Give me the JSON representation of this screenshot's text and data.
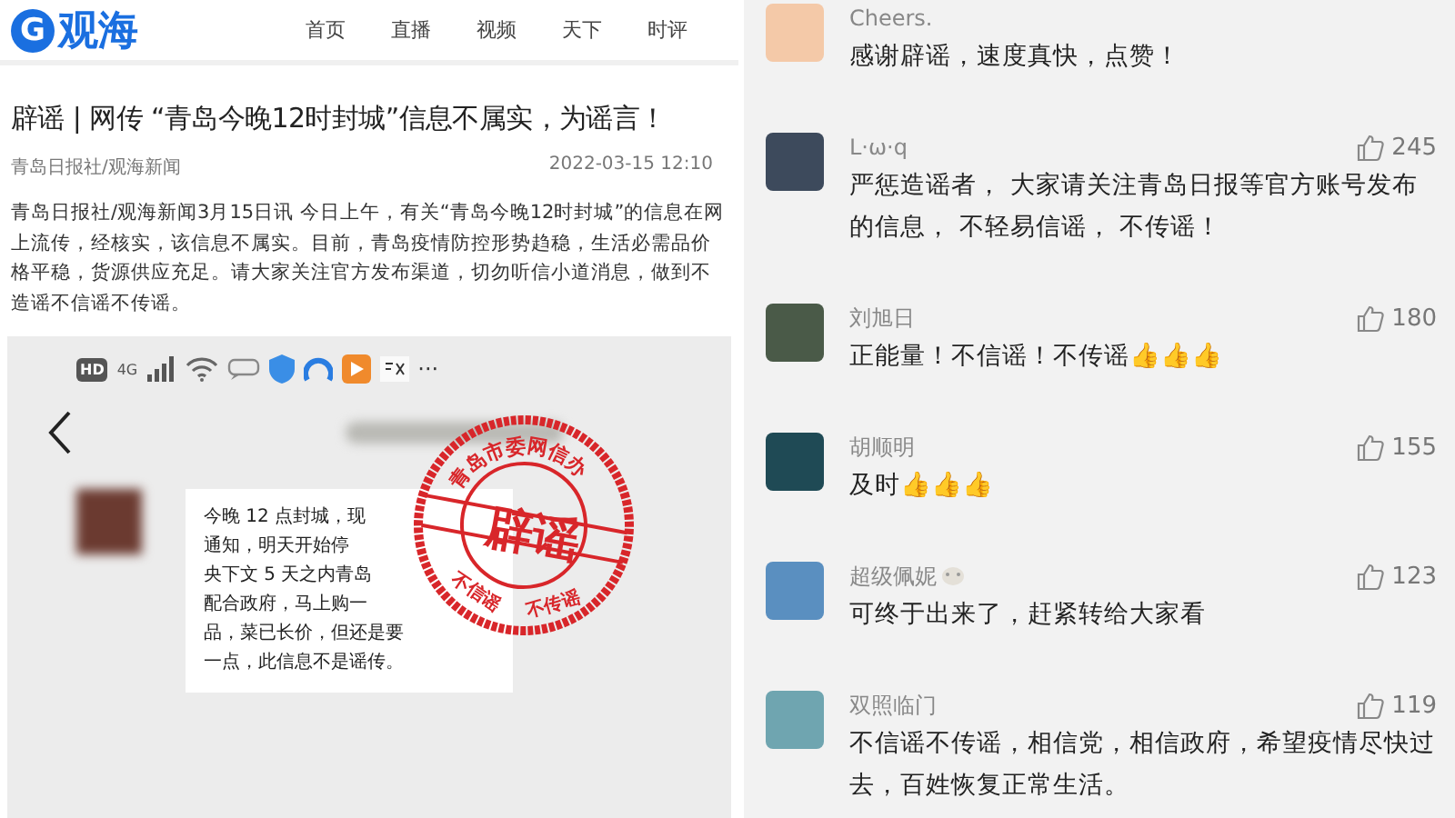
{
  "article_page": {
    "logo": {
      "mark": "G",
      "text": "观海"
    },
    "nav": [
      {
        "label": "首页"
      },
      {
        "label": "直播"
      },
      {
        "label": "视频"
      },
      {
        "label": "天下"
      },
      {
        "label": "时评"
      }
    ],
    "title": "辟谣 | 网传 “青岛今晚12时封城”信息不属实，为谣言！",
    "source": "青岛日报社/观海新闻",
    "date": "2022-03-15 12:10",
    "body": "青岛日报社/观海新闻3月15日讯 今日上午，有关“青岛今晚12时封城”的信息在网上流传，经核实，该信息不属实。目前，青岛疫情防控形势趋稳，生活必需品价格平稳，货源供应充足。请大家关注官方发布渠道，切勿听信小道消息，做到不造谣不信谣不传谣。",
    "screenshot": {
      "status_bar": {
        "hd": "HD",
        "network": "4G",
        "more": "···"
      },
      "message_lines": [
        "今晚 12 点封城，现",
        "通知，明天开始停",
        "央下文 5 天之内青岛",
        "配合政府，马上购一",
        "品，菜已长价，但还是要",
        "一点，此信息不是谣传。"
      ],
      "stamp": {
        "ring_text": "青岛市委网信办",
        "center_text": "辟谣",
        "left_text": "不信谣",
        "bottom_text": "不传谣"
      }
    }
  },
  "comments": [
    {
      "name": "Cheers.",
      "text": "感谢辟谣，速度真快，点赞！",
      "color": "#f4c9a8"
    },
    {
      "name": "L·ω·q",
      "likes": "245",
      "text": "严惩造谣者， 大家请关注青岛日报等官方账号发布的信息， 不轻易信谣， 不传谣！",
      "color": "#3d4a5c"
    },
    {
      "name": "刘旭日",
      "likes": "180",
      "text": "正能量！不信谣！不传谣👍👍👍",
      "color": "#4a5a48"
    },
    {
      "name": "胡顺明",
      "likes": "155",
      "text": "及时👍👍👍",
      "color": "#1f4a55"
    },
    {
      "name": "超级佩妮",
      "likes": "123",
      "text": "可终于出来了，赶紧转给大家看",
      "color": "#5a8fc0",
      "name_badge": true
    },
    {
      "name": "双照临门",
      "likes": "119",
      "text": "不信谣不传谣，相信党，相信政府，希望疫情尽快过去，百姓恢复正常生活。",
      "color": "#6fa5b0"
    }
  ]
}
